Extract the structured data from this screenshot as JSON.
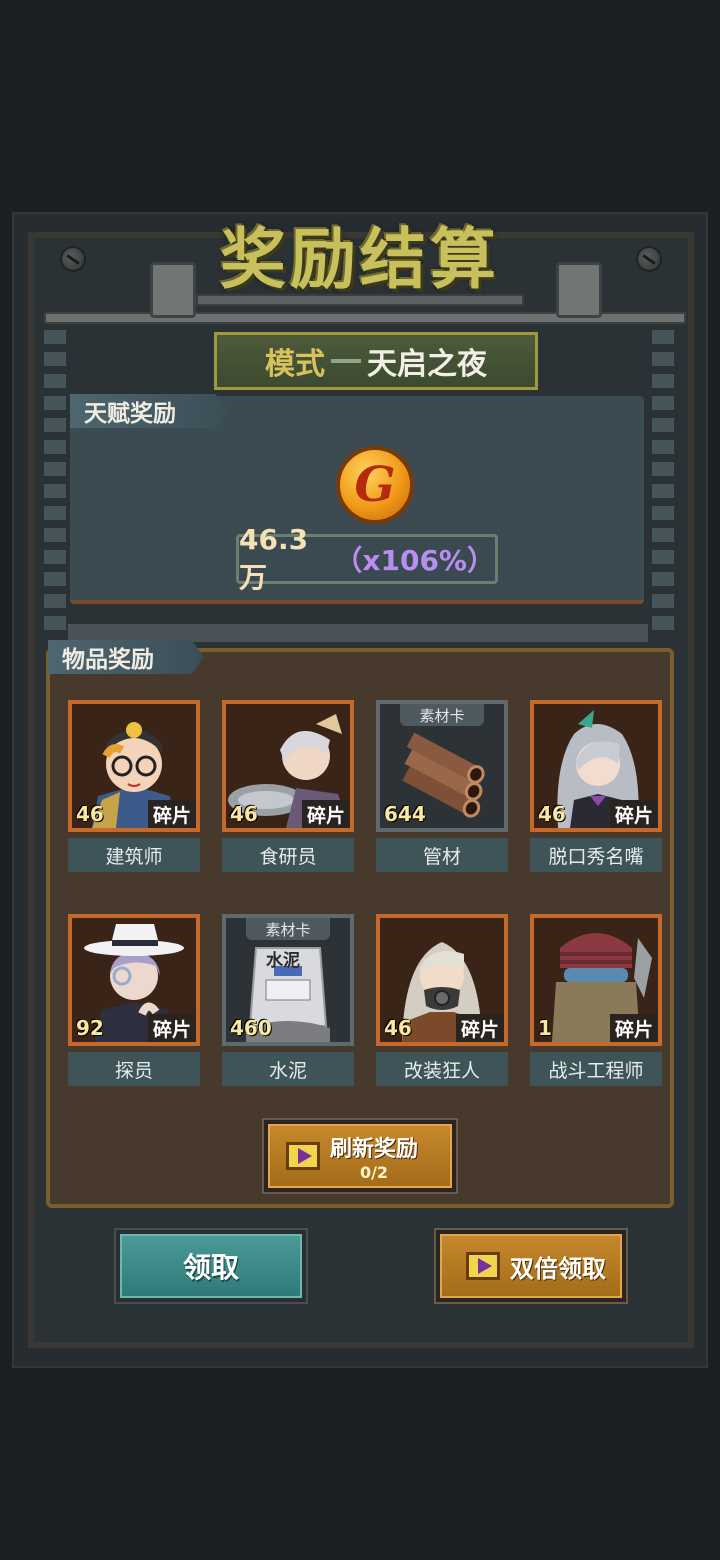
{
  "header": {
    "title": "奖励结算",
    "mode_label": "模式",
    "mode_value": "天启之夜"
  },
  "talent": {
    "tab_label": "天赋奖励",
    "currency_icon": "gold-g-coin-icon",
    "amount": "46.3万",
    "multiplier": "（x106%）"
  },
  "items": {
    "tab_label": "物品奖励",
    "list": [
      {
        "name": "建筑师",
        "qty": "46",
        "tag": "碎片",
        "kind": "fragment"
      },
      {
        "name": "食研员",
        "qty": "46",
        "tag": "碎片",
        "kind": "fragment"
      },
      {
        "name": "管材",
        "qty": "644",
        "tag": "素材卡",
        "kind": "material"
      },
      {
        "name": "脱口秀名嘴",
        "qty": "46",
        "tag": "碎片",
        "kind": "fragment"
      },
      {
        "name": "探员",
        "qty": "92",
        "tag": "碎片",
        "kind": "fragment"
      },
      {
        "name": "水泥",
        "qty": "460",
        "tag": "素材卡",
        "kind": "material",
        "label": "水泥"
      },
      {
        "name": "改装狂人",
        "qty": "46",
        "tag": "碎片",
        "kind": "fragment"
      },
      {
        "name": "战斗工程师",
        "qty": "1",
        "tag": "碎片",
        "kind": "fragment"
      }
    ]
  },
  "actions": {
    "refresh_label": "刷新奖励",
    "refresh_count": "0/2",
    "claim_label": "领取",
    "double_label": "双倍领取"
  },
  "colors": {
    "title": "#c7c05c",
    "fragment_frame": "#c56a2a",
    "claim_button": "#3a8a88",
    "double_button": "#b87a24",
    "multiplier": "#b88ef0"
  }
}
